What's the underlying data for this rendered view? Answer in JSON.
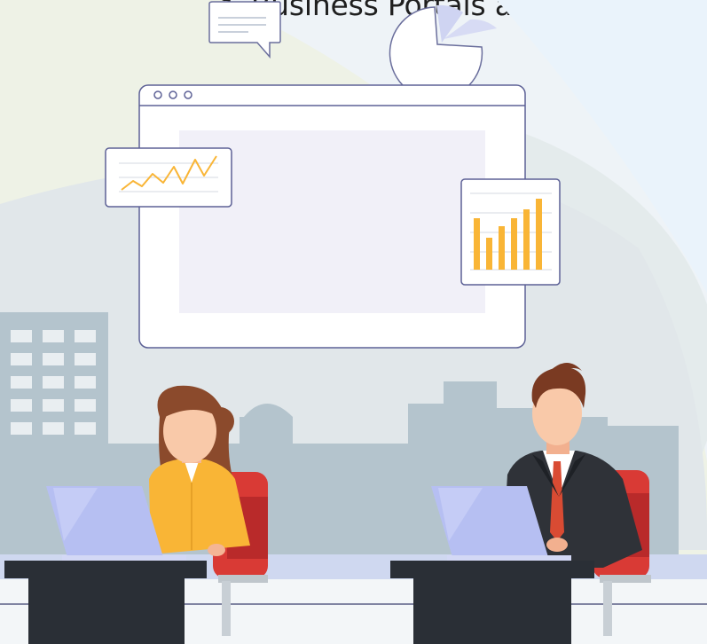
{
  "header": {
    "headline": "projects, Business Portals and Mobil"
  },
  "browser_window": {
    "dots": [
      "dot-1",
      "dot-2",
      "dot-3"
    ]
  },
  "icons": [
    "speech-bubble-icon",
    "pie-chart-icon",
    "line-chart-card",
    "bar-chart-card"
  ],
  "colors": {
    "background": "#eef3f7",
    "accent_yellow": "#f9b536",
    "outline": "#6a6e9c",
    "desk": "#2a2f36",
    "chair": "#d93a35",
    "skyline": "#b4c4cd",
    "laptop": "#b6bff2"
  }
}
